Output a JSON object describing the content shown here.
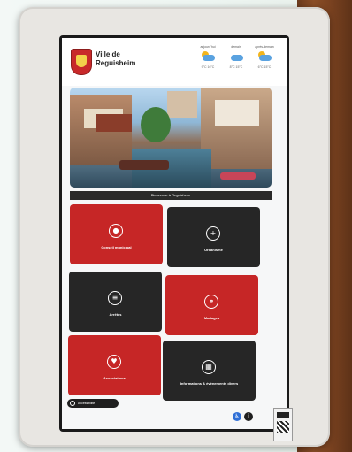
{
  "town": {
    "line1": "Ville de",
    "line2": "Reguisheim"
  },
  "weather": [
    {
      "day": "aujourd'hui",
      "temps": "9°C   16°C"
    },
    {
      "day": "demain",
      "temps": "8°C   15°C"
    },
    {
      "day": "après-demain",
      "temps": "6°C   15°C"
    }
  ],
  "welcome": "Bienvenue à Reguisheim",
  "tiles": [
    {
      "label": "Conseil municipal",
      "icon": "group-icon",
      "color": "#c62626"
    },
    {
      "label": "Urbanisme",
      "icon": "document-plus-icon",
      "color": "#262626"
    },
    {
      "label": "Arrêtés",
      "icon": "document-list-icon",
      "color": "#262626"
    },
    {
      "label": "Mariages",
      "icon": "rings-icon",
      "color": "#c62626"
    },
    {
      "label": "Associations",
      "icon": "handshake-icon",
      "color": "#c62626"
    },
    {
      "label": "Informations & évènements divers",
      "icon": "calendar-icon",
      "color": "#262626"
    }
  ],
  "accessibility": {
    "label": "Accessibilité"
  },
  "bottom_buttons": [
    {
      "icon": "wheelchair-icon",
      "color": "#2f6fd6"
    },
    {
      "icon": "info-icon",
      "color": "#1f1f1f"
    }
  ],
  "colors": {
    "accent_red": "#c62626",
    "dark_tile": "#262626"
  }
}
